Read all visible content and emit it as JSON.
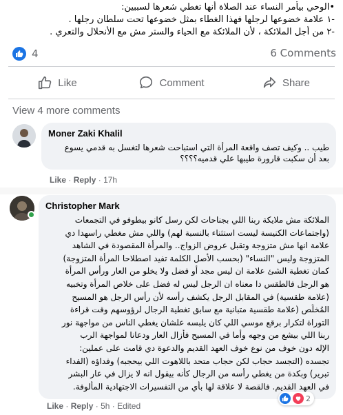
{
  "post": {
    "line1": "•الوحي بيأمر النساء عند الصلاة أنها تغطي شعرها لسببين:",
    "line2": "-١ علامة خضوعها لرجلها فهذا الغطاء بمثل خضوعها تحت سلطان رجلها .",
    "line3": "-٢ من أجل الملائكة ، لأن الملائكة مع الحياء والستر مش مع الأنحلال والتعري ."
  },
  "stats": {
    "like_count": "4",
    "comment_count": "6 Comments"
  },
  "actions": {
    "like": "Like",
    "comment": "Comment",
    "share": "Share"
  },
  "view_more": "View 4 more comments",
  "comments": [
    {
      "author": "Moner Zaki Khalil",
      "lines": [
        "طيب .. وكيف تصف واقعة المرأة التي استباحت شعرها لتغسل به قدمي يسوع",
        "بعد أن سكبت قارورة طيبها علي قدميه؟؟؟؟"
      ],
      "like": "Like",
      "reply": "Reply",
      "time": "17h"
    },
    {
      "author": "Christopher Mark",
      "lines": [
        "الملائكة مش ملايكة ربنا اللي بجناحات لكن رسل كانو بيطوفو في التجمعات",
        "(واجتماعات الكنيسة ليست استثناء بالنسبة لهم) واللي مش مغطي راسهدا دي",
        "علامة انها مش متزوجة وتقبل عروض الزواج.. والمرأة المقصودة في الشاهد",
        "المتزوجة وليس \"النساء\" (بحسب الأصل الكلمة تفيد اصطلاحا المرأة المتزوجة)",
        "كمان تغطية الشئ علامة ان ليس مجد أو فضل ولا يخلو من العار ورأس المرأة",
        "هو الرجل فالطقس دا معناه ان الرجل ليس له فضل على خلاص المرأة وتخبيه",
        "(علامة طقسية) في المقابل الرجل يكشف رأسه لأن رأس الرجل هو المسيح",
        "المُخلِّص (علامة طقسية متبانية مع سابق تغطية الرجال لرؤوسهم وقت قراءة",
        "التوراة لتكرار برقع موسي اللي كان يلبسه علشان يغطي الناس من مواجهة نور",
        "ربنا اللي بيشع من وجهه وأما في المسيح فأزال العار ودعانا لمواجهة الرب",
        "الإله دون خوف من نوع خوف العهد القديم والدعوة دي قامت على عملين:",
        "تجسده (التجسد حجاب لكن حجاب متحد باللاهوت اللي بيحجبه) وفداؤه (الفداء",
        "تبرير) وبكدة من يغطي رأسه من الرجال كأنه بيقول انه لا يزال في عار البشر",
        "في العهد القديم. فالقصة لا علاقة لها بأي من التفسيرات الاجتهادية المألوفة."
      ],
      "like": "Like",
      "reply": "Reply",
      "time": "5h · Edited",
      "reaction_count": "2"
    }
  ],
  "colors": {
    "accent": "#1b74e4",
    "muted": "#65676b",
    "bubble": "#f0f2f5",
    "online": "#31a24c"
  },
  "icons": [
    "like-icon",
    "comment-icon",
    "share-icon",
    "thumbs-up-badge-icon",
    "heart-reaction-icon"
  ]
}
